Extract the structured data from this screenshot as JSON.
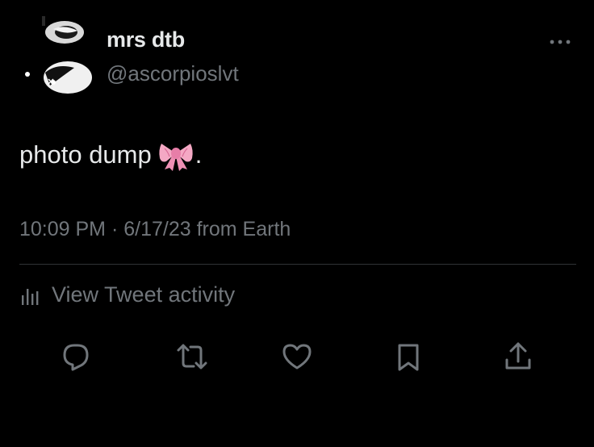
{
  "tweet": {
    "display_name": "mrs dtb",
    "handle": "@ascorpioslvt",
    "text": "photo dump",
    "text_suffix": ".",
    "emoji_icon": "ribbon-bow-icon",
    "time": "10:09 PM",
    "separator": " · ",
    "date": "6/17/23",
    "source": " from Earth",
    "activity_label": "View Tweet activity"
  },
  "icons": {
    "more": "more-dots-icon",
    "activity": "bar-chart-icon",
    "reply": "reply-bubble-icon",
    "retweet": "retweet-icon",
    "like": "heart-icon",
    "bookmark": "bookmark-icon",
    "share": "share-upload-icon"
  },
  "colors": {
    "background": "#000000",
    "primary_text": "#e7e9ea",
    "secondary_text": "#71767b",
    "divider": "#2f3336",
    "emoji_pink": "#f4a8c4"
  }
}
